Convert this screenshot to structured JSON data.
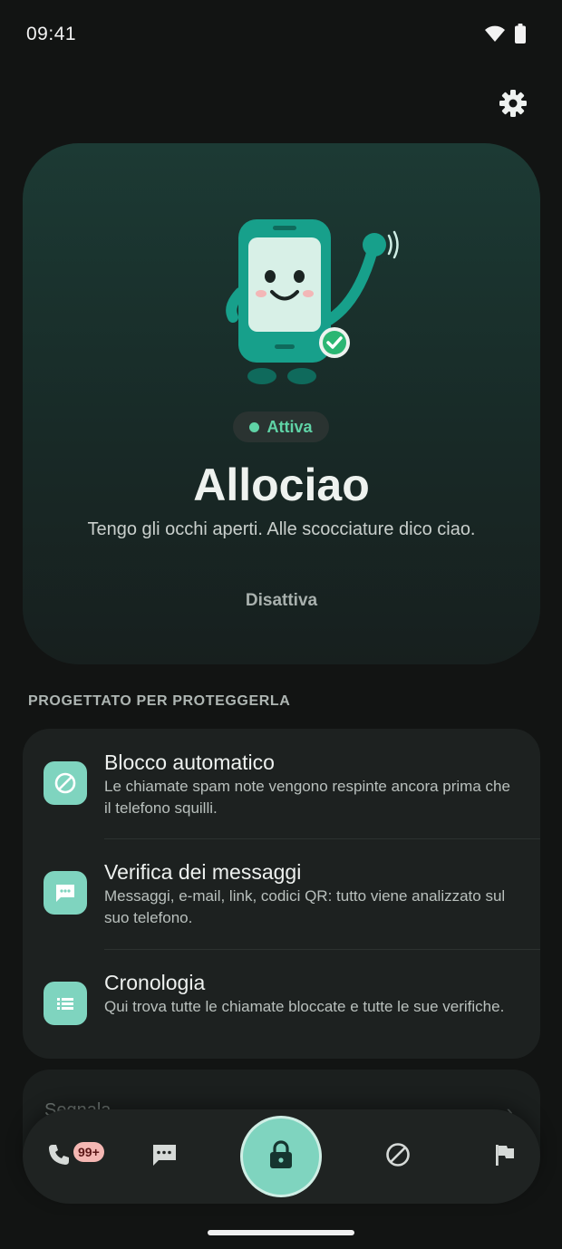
{
  "status_bar": {
    "time": "09:41",
    "icons": [
      "wifi-icon",
      "battery-icon"
    ]
  },
  "header": {
    "settings_icon": "gear-icon"
  },
  "hero": {
    "status_label": "Attiva",
    "title": "Allociao",
    "subtitle": "Tengo gli occhi aperti. Alle scocciature dico ciao.",
    "action_label": "Disattiva",
    "mascot": "waving-phone-mascot"
  },
  "features": {
    "section_label": "PROGETTATO PER PROTEGGERLA",
    "items": [
      {
        "icon": "block-icon",
        "title": "Blocco automatico",
        "description": "Le chiamate spam note vengono respinte ancora prima che il telefono squilli."
      },
      {
        "icon": "message-icon",
        "title": "Verifica dei messaggi",
        "description": "Messaggi, e-mail, link, codici QR: tutto viene analizzato sul suo telefono."
      },
      {
        "icon": "list-icon",
        "title": "Cronologia",
        "description": "Qui trova tutte le chiamate bloccate e tutte le sue verifiche."
      }
    ]
  },
  "peek_card": {
    "label": "Segnala",
    "chevron": "›"
  },
  "bottom_nav": {
    "calls_badge": "99+",
    "items": [
      "phone-icon",
      "message-icon",
      "lock-icon",
      "block-icon",
      "flag-icon"
    ]
  },
  "colors": {
    "accent": "#7fd4bf",
    "active_green": "#5fd3a6",
    "background": "#121413",
    "badge": "#f4b7b3"
  }
}
